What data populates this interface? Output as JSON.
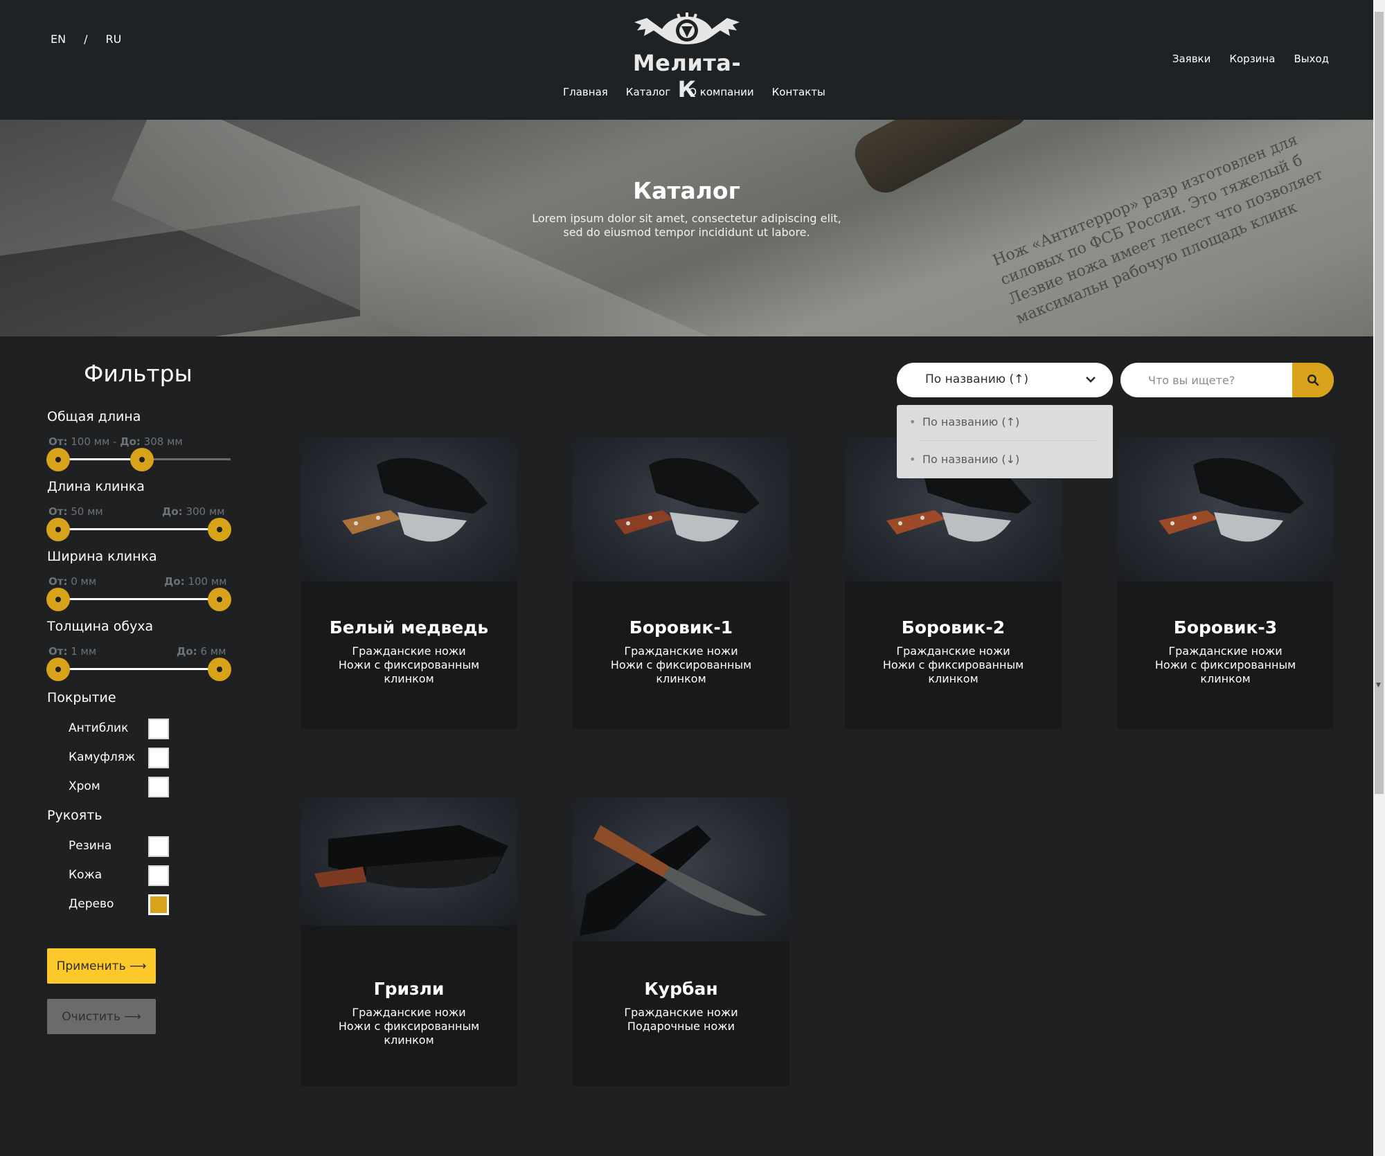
{
  "header": {
    "lang": [
      "EN",
      "RU"
    ],
    "lang_sep": "/",
    "logo_text": "Мелита-К",
    "nav": [
      "Главная",
      "Каталог",
      "О компании",
      "Контакты"
    ],
    "user_menu": [
      "Заявки",
      "Корзина",
      "Выход"
    ]
  },
  "hero": {
    "title": "Каталог",
    "subtitle_line1": "Lorem ipsum dolor sit amet, consectetur adipiscing elit,",
    "subtitle_line2": "sed do eiusmod tempor incididunt ut labore.",
    "bg_text": "Нож «Антитеррор» разр изготовлен для силовых по ФСБ России. Это тяжелый б Лезвие ножа имеет лепест что позволяет максимальн рабочую площадь клинк"
  },
  "filters": {
    "title": "Фильтры",
    "ranges": [
      {
        "label": "Общая длина",
        "from_label": "От:",
        "from": "100 мм",
        "joiner": "-",
        "to_label": "До:",
        "to": "308 мм",
        "min_frac": 0.0,
        "max_frac": 0.5
      },
      {
        "label": "Длина клинка",
        "from_label": "От:",
        "from": "50 мм",
        "to_label": "До:",
        "to": "300 мм",
        "min_frac": 0.0,
        "max_frac": 1.0
      },
      {
        "label": "Ширина клинка",
        "from_label": "От:",
        "from": "0 мм",
        "to_label": "До:",
        "to": "100 мм",
        "min_frac": 0.0,
        "max_frac": 1.0
      },
      {
        "label": "Толщина обуха",
        "from_label": "От:",
        "from": "1 мм",
        "to_label": "До:",
        "to": "6 мм",
        "min_frac": 0.0,
        "max_frac": 1.0
      }
    ],
    "coating": {
      "label": "Покрытие",
      "options": [
        {
          "label": "Антиблик",
          "checked": false
        },
        {
          "label": "Камуфляж",
          "checked": false
        },
        {
          "label": "Хром",
          "checked": false
        }
      ]
    },
    "handle": {
      "label": "Рукоять",
      "options": [
        {
          "label": "Резина",
          "checked": false
        },
        {
          "label": "Кожа",
          "checked": false
        },
        {
          "label": "Дерево",
          "checked": true
        }
      ]
    },
    "apply_label": "Применить ⟶",
    "clear_label": "Очистить ⟶"
  },
  "toolbar": {
    "sort_selected": "По названию (↑)",
    "sort_options": [
      "По названию (↑)",
      "По названию (↓)"
    ],
    "search_placeholder": "Что вы ищете?"
  },
  "products": [
    {
      "name": "Белый медведь",
      "categories": [
        "Гражданские ножи",
        "Ножи с фиксированным",
        "клинком"
      ]
    },
    {
      "name": "Боровик-1",
      "categories": [
        "Гражданские ножи",
        "Ножи с фиксированным",
        "клинком"
      ]
    },
    {
      "name": "Боровик-2",
      "categories": [
        "Гражданские ножи",
        "Ножи с фиксированным",
        "клинком"
      ]
    },
    {
      "name": "Боровик-3",
      "categories": [
        "Гражданские ножи",
        "Ножи с фиксированным",
        "клинком"
      ]
    },
    {
      "name": "Гризли",
      "categories": [
        "Гражданские ножи",
        "Ножи с фиксированным",
        "клинком"
      ]
    },
    {
      "name": "Курбан",
      "categories": [
        "Гражданские ножи",
        "Подарочные ножи"
      ]
    }
  ],
  "colors": {
    "accent": "#d8a21a",
    "apply_button": "#fcc82a",
    "background": "#1e2022",
    "card": "#18191b"
  }
}
